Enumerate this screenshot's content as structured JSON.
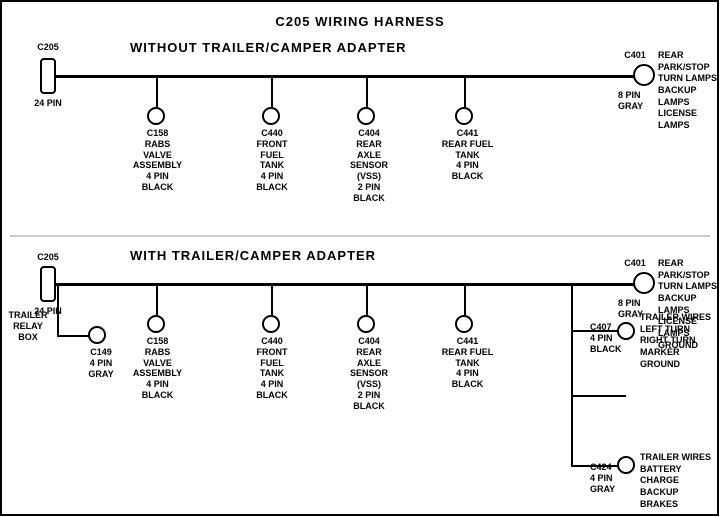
{
  "title": "C205 WIRING HARNESS",
  "top_section": {
    "title": "WITHOUT TRAILER/CAMPER ADAPTER",
    "left_connector": {
      "label": "C205",
      "pin_label": "24 PIN"
    },
    "right_connector": {
      "label": "C401",
      "pin_label": "8 PIN\nGRAY",
      "description": "REAR PARK/STOP\nTURN LAMPS\nBACKUP LAMPS\nLICENSE LAMPS"
    },
    "connectors": [
      {
        "id": "C158",
        "label": "C158\nRABS VALVE\nASSEMBLY\n4 PIN BLACK"
      },
      {
        "id": "C440",
        "label": "C440\nFRONT FUEL\nTANK\n4 PIN BLACK"
      },
      {
        "id": "C404",
        "label": "C404\nREAR AXLE\nSENSOR\n(VSS)\n2 PIN BLACK"
      },
      {
        "id": "C441",
        "label": "C441\nREAR FUEL\nTANK\n4 PIN BLACK"
      }
    ]
  },
  "bottom_section": {
    "title": "WITH TRAILER/CAMPER ADAPTER",
    "left_connector": {
      "label": "C205",
      "pin_label": "24 PIN"
    },
    "right_connector": {
      "label": "C401",
      "pin_label": "8 PIN\nGRAY",
      "description": "REAR PARK/STOP\nTURN LAMPS\nBACKUP LAMPS\nLICENSE LAMPS\nGROUND"
    },
    "extra_left": {
      "label": "TRAILER\nRELAY\nBOX",
      "connector_label": "C149\n4 PIN GRAY"
    },
    "connectors": [
      {
        "id": "C158",
        "label": "C158\nRABS VALVE\nASSEMBLY\n4 PIN BLACK"
      },
      {
        "id": "C440",
        "label": "C440\nFRONT FUEL\nTANK\n4 PIN BLACK"
      },
      {
        "id": "C404",
        "label": "C404\nREAR AXLE\nSENSOR\n(VSS)\n2 PIN BLACK"
      },
      {
        "id": "C441",
        "label": "C441\nREAR FUEL\nTANK\n4 PIN BLACK"
      }
    ],
    "right_extras": [
      {
        "connector_label": "C407\n4 PIN\nBLACK",
        "description": "TRAILER WIRES\nLEFT TURN\nRIGHT TURN\nMARKER\nGROUND"
      },
      {
        "connector_label": "C424\n4 PIN\nGRAY",
        "description": "TRAILER WIRES\nBATTERY CHARGE\nBACKUP\nBRAKES"
      }
    ]
  }
}
